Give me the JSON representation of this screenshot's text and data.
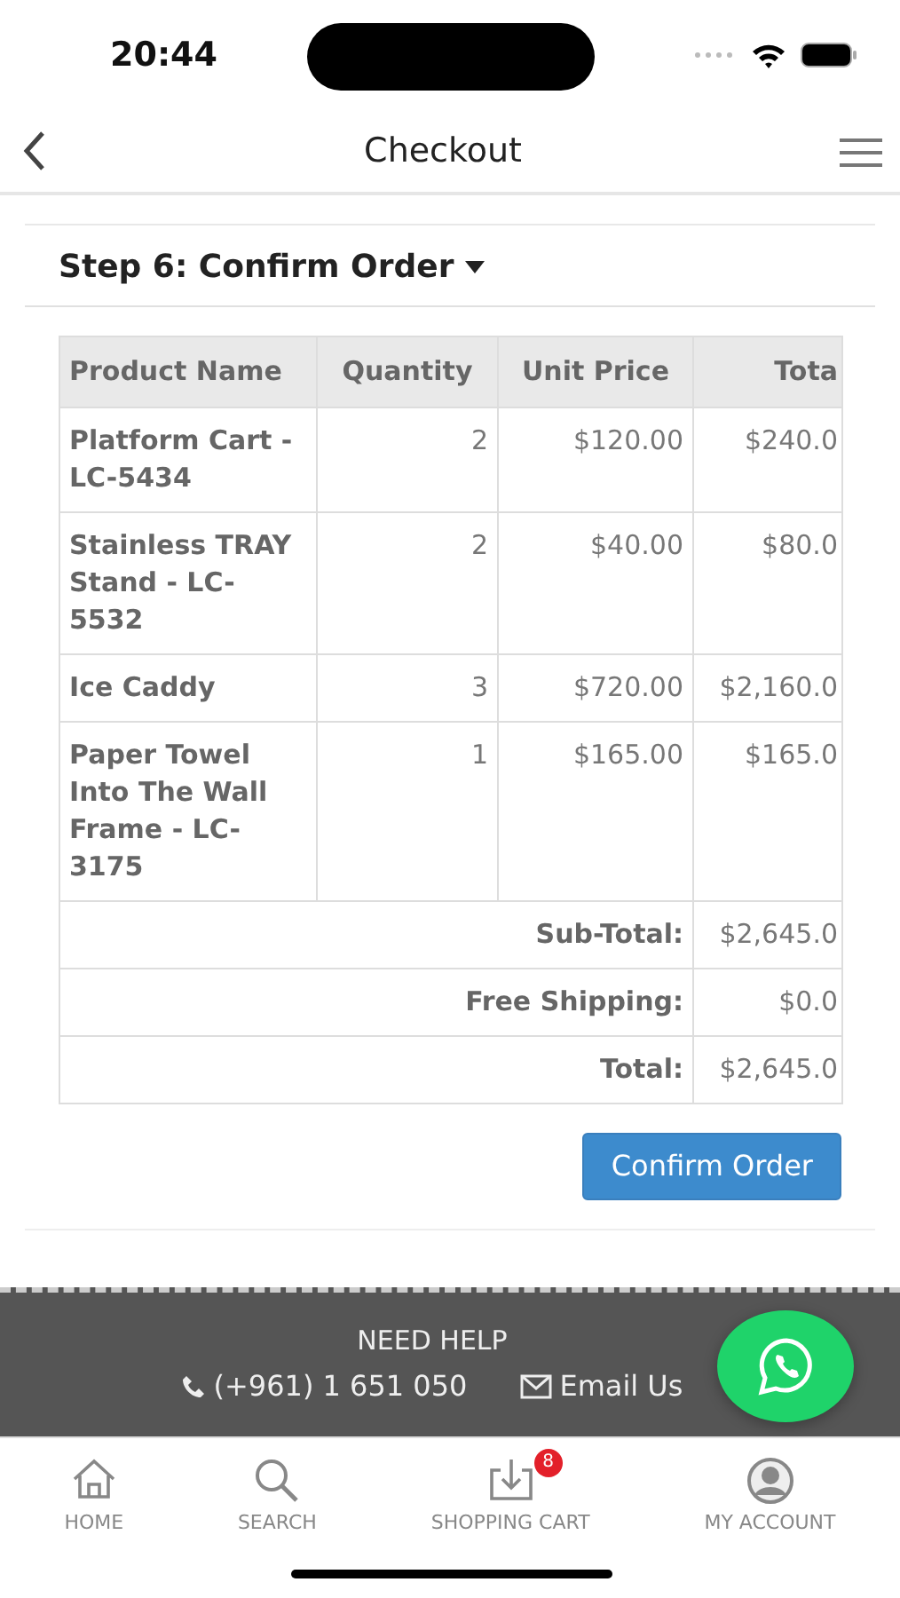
{
  "status_bar": {
    "time": "20:44"
  },
  "header": {
    "title": "Checkout"
  },
  "step": {
    "label": "Step 6: Confirm Order",
    "expanded": true
  },
  "table": {
    "columns": [
      "Product Name",
      "Quantity",
      "Unit Price",
      "Tota"
    ],
    "rows": [
      {
        "name": "Platform Cart - LC-5434",
        "quantity": "2",
        "unit_price": "$120.00",
        "total": "$240.0"
      },
      {
        "name": "Stainless TRAY Stand - LC-5532",
        "quantity": "2",
        "unit_price": "$40.00",
        "total": "$80.0"
      },
      {
        "name": "Ice Caddy",
        "quantity": "3",
        "unit_price": "$720.00",
        "total": "$2,160.0"
      },
      {
        "name": "Paper Towel Into The Wall Frame - LC-3175",
        "quantity": "1",
        "unit_price": "$165.00",
        "total": "$165.0"
      }
    ],
    "totals": [
      {
        "label": "Sub-Total:",
        "value": "$2,645.0"
      },
      {
        "label": "Free Shipping:",
        "value": "$0.0"
      },
      {
        "label": "Total:",
        "value": "$2,645.0"
      }
    ]
  },
  "confirm_button": "Confirm Order",
  "help": {
    "title": "NEED HELP",
    "phone": "(+961) 1 651 050",
    "email": "Email Us"
  },
  "tab_bar": [
    {
      "kind": "home",
      "label": "HOME"
    },
    {
      "kind": "search",
      "label": "SEARCH"
    },
    {
      "kind": "cart",
      "label": "SHOPPING CART",
      "badge": "8"
    },
    {
      "kind": "account",
      "label": "MY ACCOUNT"
    }
  ]
}
